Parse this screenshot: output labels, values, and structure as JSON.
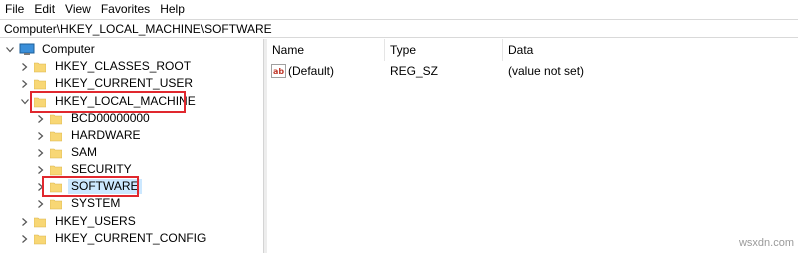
{
  "menu": [
    "File",
    "Edit",
    "View",
    "Favorites",
    "Help"
  ],
  "address": "Computer\\HKEY_LOCAL_MACHINE\\SOFTWARE",
  "tree": {
    "root": "Computer",
    "hives": [
      "HKEY_CLASSES_ROOT",
      "HKEY_CURRENT_USER",
      "HKEY_LOCAL_MACHINE",
      "HKEY_USERS",
      "HKEY_CURRENT_CONFIG"
    ],
    "hklm_children": [
      "BCD00000000",
      "HARDWARE",
      "SAM",
      "SECURITY",
      "SOFTWARE",
      "SYSTEM"
    ],
    "selected": "SOFTWARE",
    "expanded": [
      "Computer",
      "HKEY_LOCAL_MACHINE"
    ]
  },
  "list": {
    "columns": [
      "Name",
      "Type",
      "Data"
    ],
    "rows": [
      {
        "name": "(Default)",
        "type": "REG_SZ",
        "data": "(value not set)"
      }
    ]
  },
  "highlight_color": "#e0282e",
  "selection_color": "#cce8ff",
  "folder_color": "#f8d775",
  "watermark": "wsxdn.com"
}
